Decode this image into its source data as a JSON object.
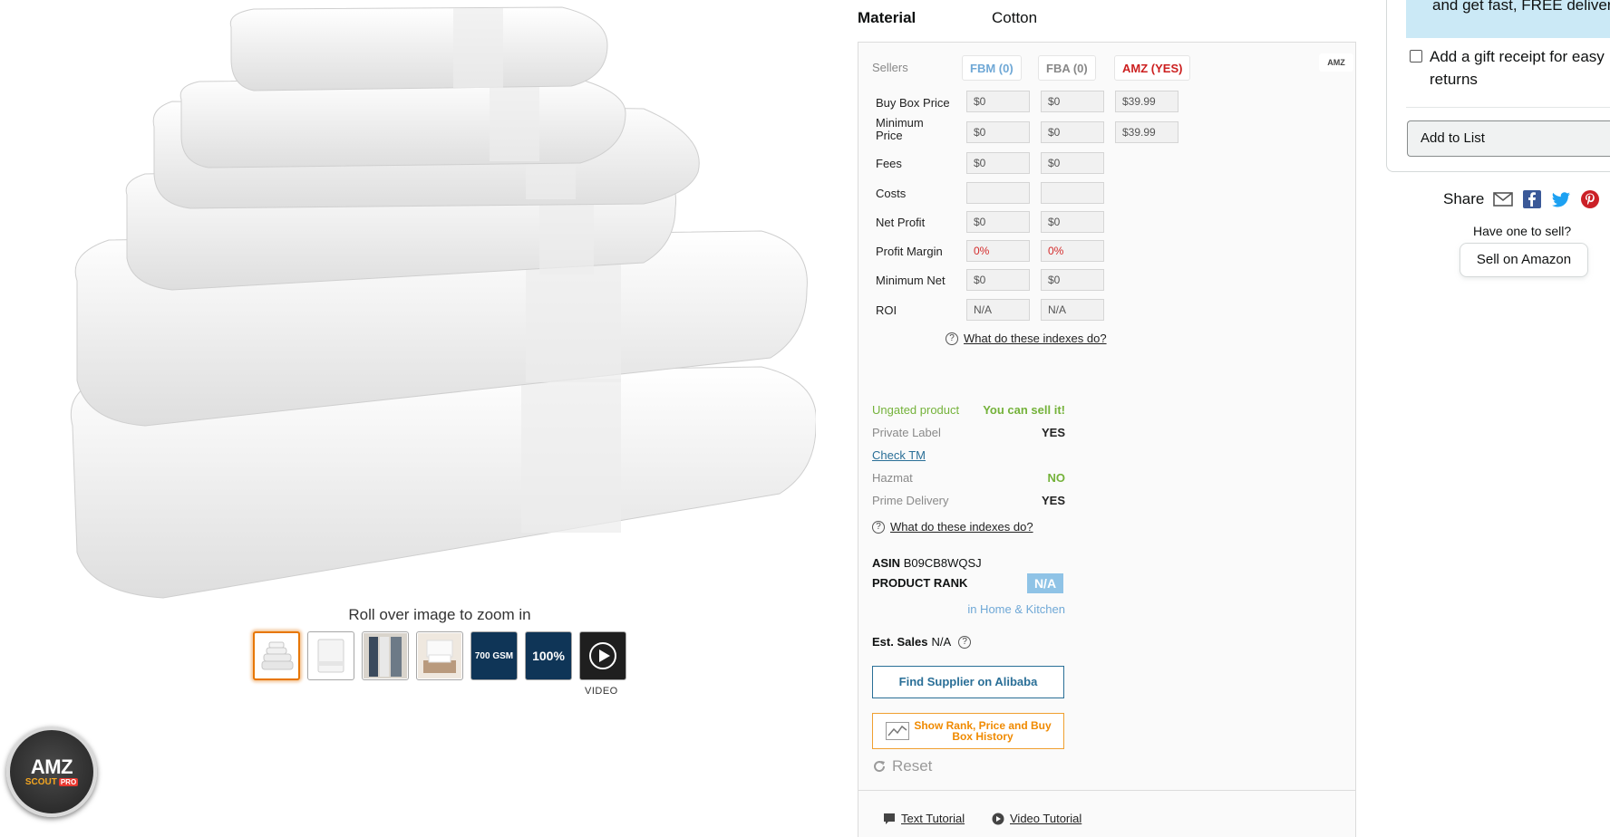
{
  "product": {
    "zoom_hint": "Roll over image to zoom in",
    "video_label": "VIDEO",
    "thumbnails": [
      {
        "name": "thumbnail-towel-stack",
        "text": ""
      },
      {
        "name": "thumbnail-single-towel",
        "text": ""
      },
      {
        "name": "thumbnail-hanging-towels",
        "text": ""
      },
      {
        "name": "thumbnail-bathroom-towels",
        "text": ""
      },
      {
        "name": "thumbnail-700-gsm",
        "text": "700 GSM"
      },
      {
        "name": "thumbnail-100-percent",
        "text": "100%"
      },
      {
        "name": "thumbnail-video",
        "text": ""
      }
    ]
  },
  "material": {
    "label": "Material",
    "value": "Cotton"
  },
  "amzscout": {
    "badge_big": "AMZ",
    "badge_small": "SCOUT",
    "badge_pro": "PRO",
    "sellers_label": "Sellers",
    "tabs": {
      "fbm": "FBM (0)",
      "fba": "FBA (0)",
      "amz": "AMZ (YES)"
    },
    "rows": [
      {
        "label": "Buy Box Price",
        "fbm": "$0",
        "fba": "$0",
        "amz": "$39.99"
      },
      {
        "label": "Minimum Price",
        "fbm": "$0",
        "fba": "$0",
        "amz": "$39.99"
      },
      {
        "label": "Fees",
        "fbm": "$0",
        "fba": "$0"
      },
      {
        "label": "Costs",
        "fbm": "",
        "fba": ""
      },
      {
        "label": "Net Profit",
        "fbm": "$0",
        "fba": "$0"
      },
      {
        "label": "Profit Margin",
        "fbm": "0%",
        "fba": "0%"
      },
      {
        "label": "Minimum Net",
        "fbm": "$0",
        "fba": "$0"
      },
      {
        "label": "ROI",
        "fbm": "N/A",
        "fba": "N/A"
      }
    ],
    "help_text": "What do these indexes do?",
    "ungated_label": "Ungated product",
    "ungated_value": "You can sell it!",
    "private_label": "Private Label",
    "private_value": "YES",
    "check_tm": "Check TM",
    "hazmat_label": "Hazmat",
    "hazmat_value": "NO",
    "prime_label": "Prime Delivery",
    "prime_value": "YES",
    "asin_label": "ASIN",
    "asin_value": "B09CB8WQSJ",
    "rank_label": "PRODUCT RANK",
    "rank_value": "N/A",
    "rank_category": "in Home & Kitchen",
    "est_sales_label": "Est. Sales",
    "est_sales_value": "N/A",
    "alibaba_button": "Find Supplier on Alibaba",
    "history_button": "Show Rank, Price and Buy Box History",
    "reset": "Reset",
    "text_tutorial": "Text Tutorial",
    "video_tutorial": "Video Tutorial"
  },
  "buybox": {
    "delivery_text": "and get fast, FREE delivery",
    "gift_receipt": "Add a gift receipt for easy returns",
    "add_to_list": "Add to List",
    "share_label": "Share",
    "have_one": "Have one to sell?",
    "sell_button": "Sell on Amazon"
  },
  "colors": {
    "accent_orange": "#e77600",
    "scout_blue": "#2a6f97",
    "scout_red": "#cc1f1f",
    "scout_green": "#74b23a",
    "delivery_bg": "#cbe9f6"
  }
}
